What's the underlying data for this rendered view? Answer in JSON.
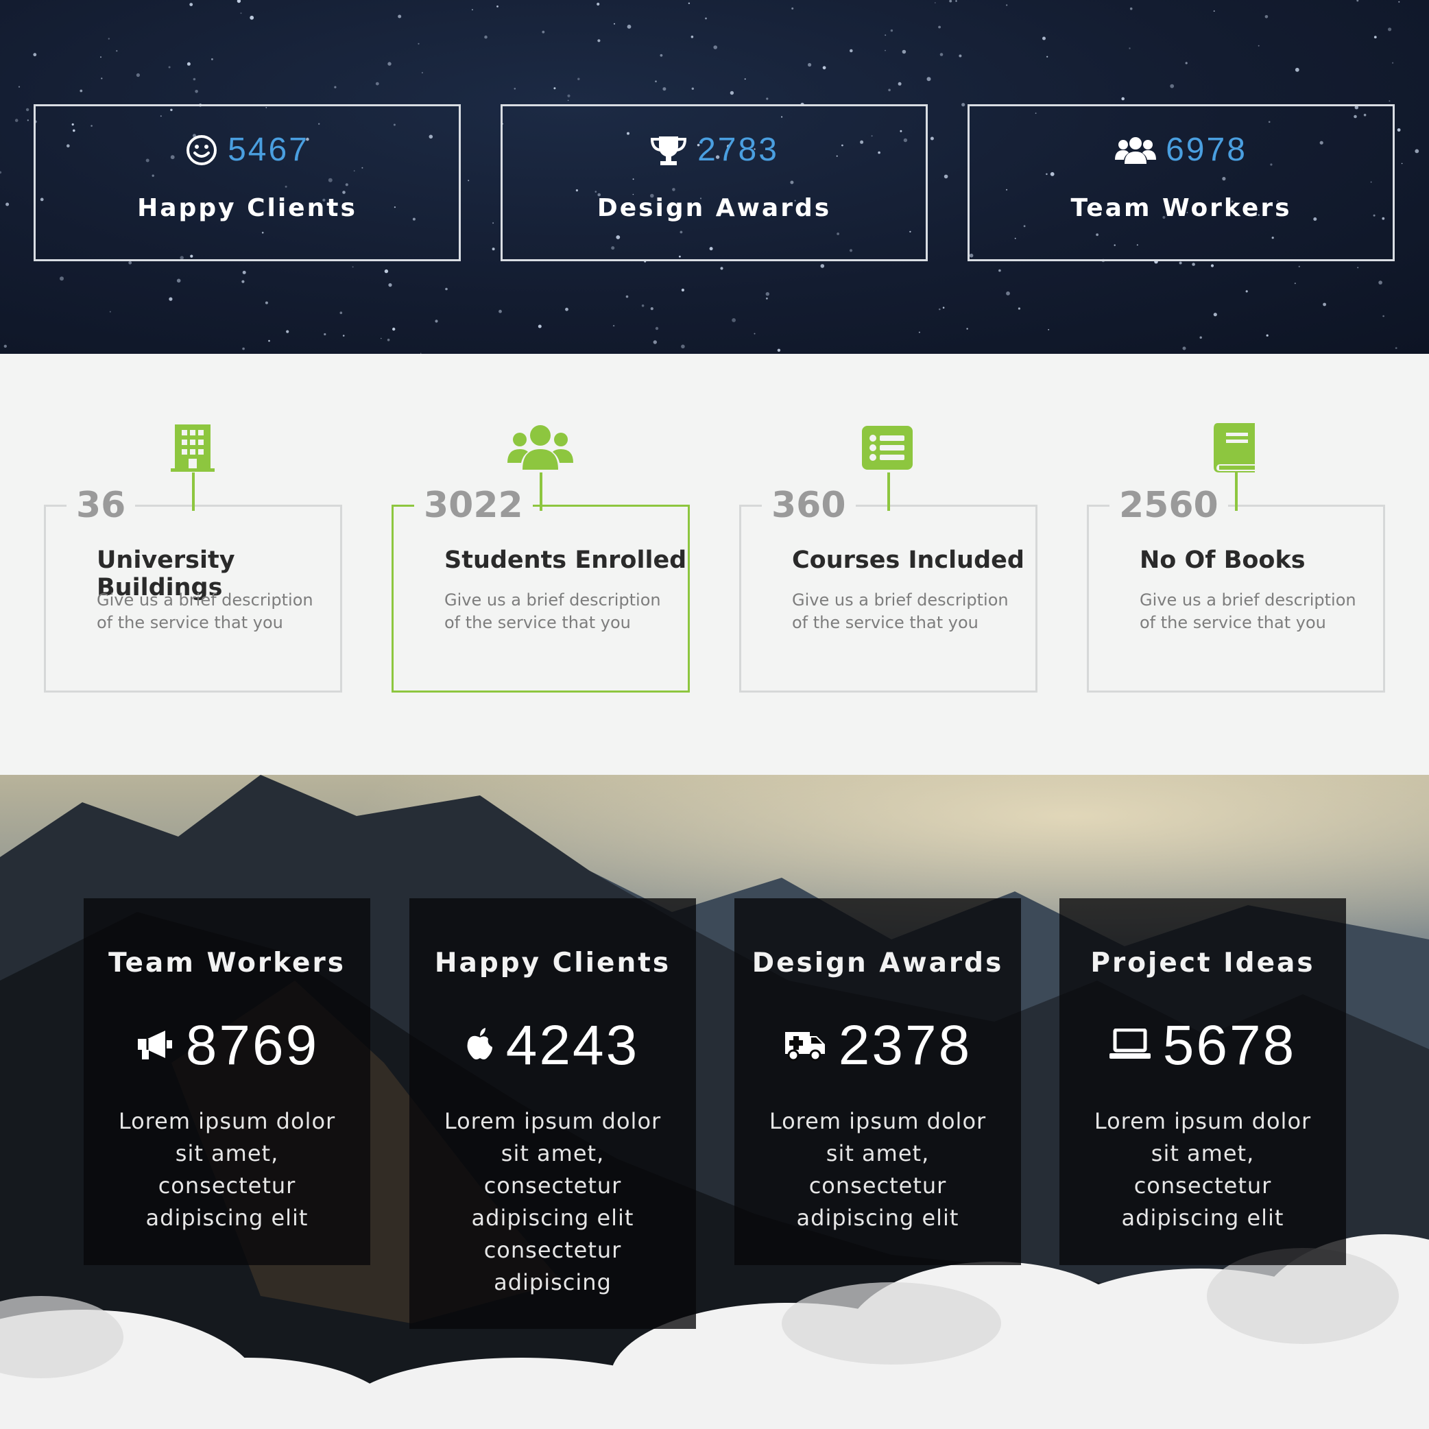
{
  "stats_stars": [
    {
      "icon": "smiley-icon",
      "count": "5467",
      "label": "Happy Clients"
    },
    {
      "icon": "trophy-icon",
      "count": "2783",
      "label": "Design Awards"
    },
    {
      "icon": "users-icon",
      "count": "6978",
      "label": "Team Workers"
    }
  ],
  "facts": [
    {
      "icon": "building-icon",
      "number": "36",
      "title": "University Buildings",
      "description": "Give us a brief description of the service that you"
    },
    {
      "icon": "users-icon",
      "number": "3022",
      "title": "Students Enrolled",
      "description": "Give us a brief description of the service that you"
    },
    {
      "icon": "list-icon",
      "number": "360",
      "title": "Courses Included",
      "description": "Give us a brief description of the service that you"
    },
    {
      "icon": "book-icon",
      "number": "2560",
      "title": "No Of Books",
      "description": "Give us a brief description of the service that you"
    }
  ],
  "mountain_stats": [
    {
      "title": "Team Workers",
      "icon": "bullhorn-icon",
      "count": "8769",
      "text": "Lorem ipsum dolor sit amet, consectetur adipiscing elit"
    },
    {
      "title": "Happy Clients",
      "icon": "apple-icon",
      "count": "4243",
      "text": "Lorem ipsum dolor sit amet, consectetur adipiscing elit consectetur adipiscing"
    },
    {
      "title": "Design Awards",
      "icon": "ambulance-icon",
      "count": "2378",
      "text": "Lorem ipsum dolor sit amet, consectetur adipiscing elit"
    },
    {
      "title": "Project Ideas",
      "icon": "laptop-icon",
      "count": "5678",
      "text": "Lorem ipsum dolor sit amet, consectetur adipiscing elit"
    }
  ],
  "colors": {
    "count_blue": "#4a9fe0",
    "accent_green": "#8dc63f",
    "night_bg": "#131c30"
  }
}
